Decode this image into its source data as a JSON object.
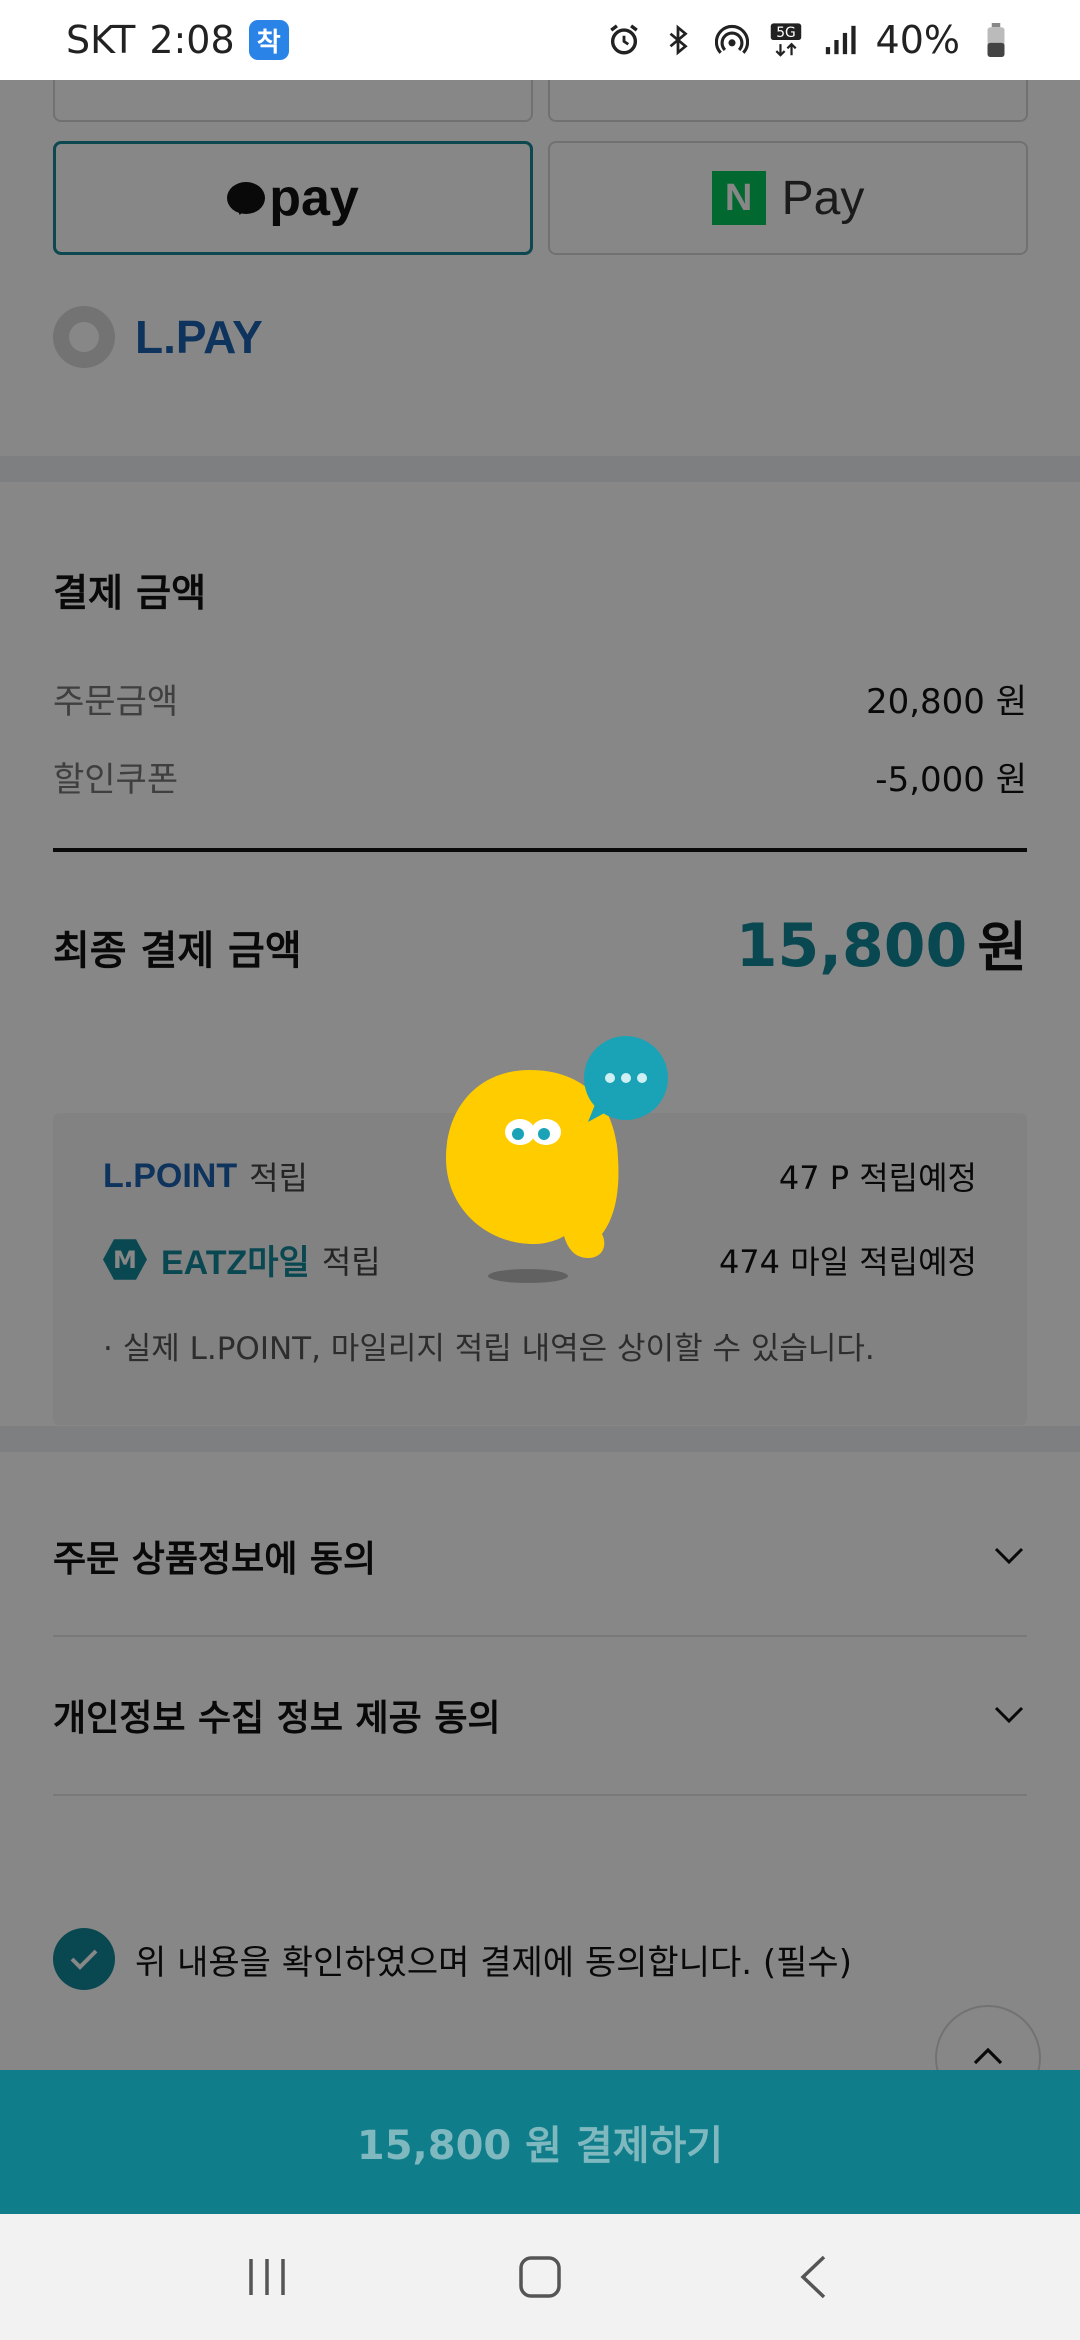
{
  "status_bar": {
    "carrier": "SKT",
    "time": "2:08",
    "app_badge": "착",
    "battery": "40%",
    "icons": [
      "alarm-icon",
      "bluetooth-icon",
      "hotspot-icon",
      "5g-icon",
      "signal-icon",
      "battery-icon"
    ]
  },
  "payment_methods": {
    "kakao_label": "pay",
    "naver_logo": "N",
    "naver_label": "Pay",
    "lpay_label": "L.PAY"
  },
  "summary": {
    "title": "결제 금액",
    "order_label": "주문금액",
    "order_value": "20,800 원",
    "coupon_label": "할인쿠폰",
    "coupon_value": "-5,000 원",
    "final_label": "최종 결제 금액",
    "final_value": "15,800",
    "final_unit": "원"
  },
  "points": {
    "lpoint_brand": "L.POINT",
    "lpoint_earn": "적립",
    "lpoint_amount": "47 P  적립예정",
    "eatz_badge": "M",
    "eatz_brand": "EATZ마일",
    "eatz_earn": "적립",
    "eatz_amount": "474 마일  적립예정",
    "note": "· 실제 L.POINT, 마일리지 적립 내역은 상이할 수 있습니다."
  },
  "agreements": {
    "product_info": "주문 상품정보에 동의",
    "privacy": "개인정보 수집 정보 제공 동의",
    "confirm": "위 내용을 확인하였으며 결제에 동의합니다. (필수)"
  },
  "submit_label": "15,800 원 결제하기",
  "colors": {
    "accent": "#14889a",
    "submit_bg": "#0f7d8a",
    "mascot": "#ffcc00",
    "bubble": "#1aa3b6"
  }
}
